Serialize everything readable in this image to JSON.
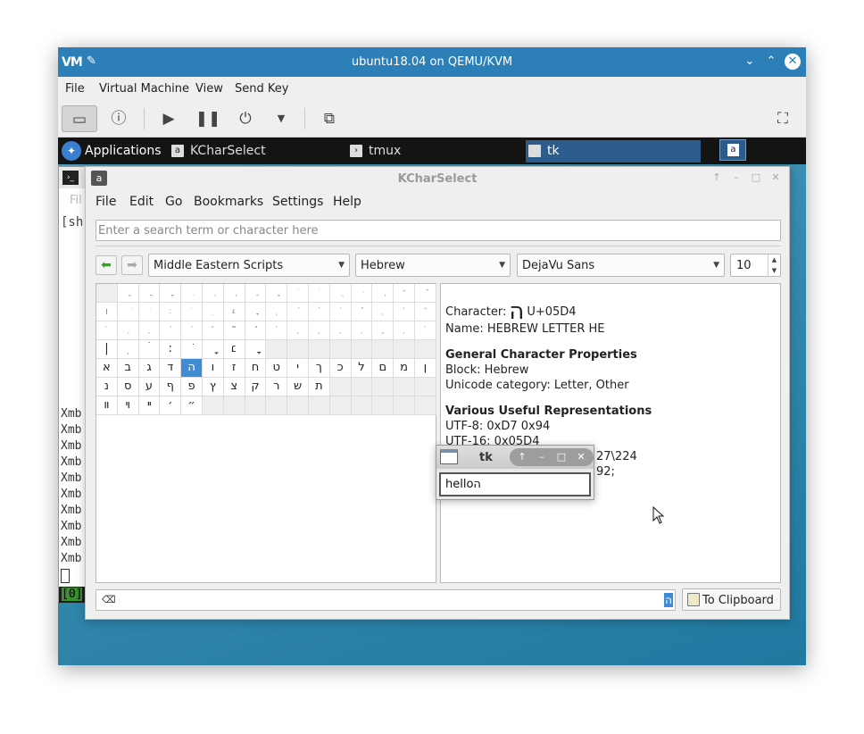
{
  "host": {
    "logo": "VM",
    "title": "ubuntu18.04 on QEMU/KVM",
    "menu": [
      "File",
      "Virtual Machine",
      "View",
      "Send Key"
    ]
  },
  "panel": {
    "applications": "Applications",
    "tasks": [
      "KCharSelect",
      "tmux",
      "tk"
    ]
  },
  "terminal": {
    "file_menu": "Fil",
    "shell": "[sh",
    "lines": [
      "Xmb",
      "Xmb",
      "Xmb",
      "Xmb",
      "Xmb",
      "Xmb",
      "Xmb",
      "Xmb",
      "Xmb",
      "Xmb"
    ],
    "status": "[0]"
  },
  "kcharselect": {
    "title": "KCharSelect",
    "menu": {
      "file": "File",
      "edit": "Edit",
      "go": "Go",
      "bookmarks": "Bookmarks",
      "settings": "Settings",
      "help": "Help"
    },
    "search_placeholder": "Enter a search term or character here",
    "section": "Middle Eastern Scripts",
    "block": "Hebrew",
    "font": "DejaVu Sans",
    "font_size": "10",
    "grid": {
      "rows": [
        [
          "",
          "ֱ",
          "ֲ",
          "ֳ",
          "ִ",
          "ֵ",
          "ֶ",
          "ַ",
          "ָ",
          "ֹ",
          "ֺ",
          "ֻ",
          "ּ",
          "ֽ",
          "־",
          "ֿ"
        ],
        [
          "׀",
          "ׁ",
          "ׂ",
          "׃",
          "ׄ",
          "ׅ",
          "׆",
          "ׇ",
          "֑",
          "֒",
          "֓",
          "֔",
          "֕",
          "֖",
          "֗",
          "֘"
        ],
        [
          "֙",
          "֚",
          "֛",
          "֜",
          "֝",
          "֞",
          "֟",
          "֠",
          "֡",
          "֢",
          "֣",
          "֤",
          "֥",
          "֦",
          "֧",
          "֨"
        ],
        [
          "|",
          "ׅ",
          "ׄ",
          ":",
          "ׂ",
          "ָ",
          "׆",
          "ׇ",
          "",
          "",
          "",
          "",
          "",
          "",
          "",
          ""
        ],
        [
          "א",
          "ב",
          "ג",
          "ד",
          "ה",
          "ו",
          "ז",
          "ח",
          "ט",
          "י",
          "ך",
          "כ",
          "ל",
          "ם",
          "מ",
          "ן"
        ],
        [
          "נ",
          "ס",
          "ע",
          "ף",
          "פ",
          "ץ",
          "צ",
          "ק",
          "ר",
          "ש",
          "ת",
          "",
          "",
          "",
          "",
          ""
        ],
        [
          "װ",
          "ױ",
          "ײ",
          "׳",
          "״",
          "",
          "",
          "",
          "",
          "",
          "",
          "",
          "",
          "",
          "",
          ""
        ]
      ],
      "small_rows": [
        0,
        1,
        2
      ],
      "selected": [
        4,
        4
      ]
    },
    "info": {
      "character_label": "Character:",
      "character": "ה",
      "codepoint": "U+05D4",
      "name": "Name: HEBREW LETTER HE",
      "general_heading": "General Character Properties",
      "block": "Block: Hebrew",
      "category": "Unicode category: Letter, Other",
      "useful_heading": "Various Useful Representations",
      "utf8": "UTF-8: 0xD7 0x94",
      "utf16": "UTF-16: 0x05D4",
      "c_octal_tail": "27\\224",
      "xml_tail": "92;"
    },
    "bottom_text": "ה",
    "to_clipboard": "To Clipboard"
  },
  "tk": {
    "title": "tk",
    "entry_text": "helloה"
  }
}
